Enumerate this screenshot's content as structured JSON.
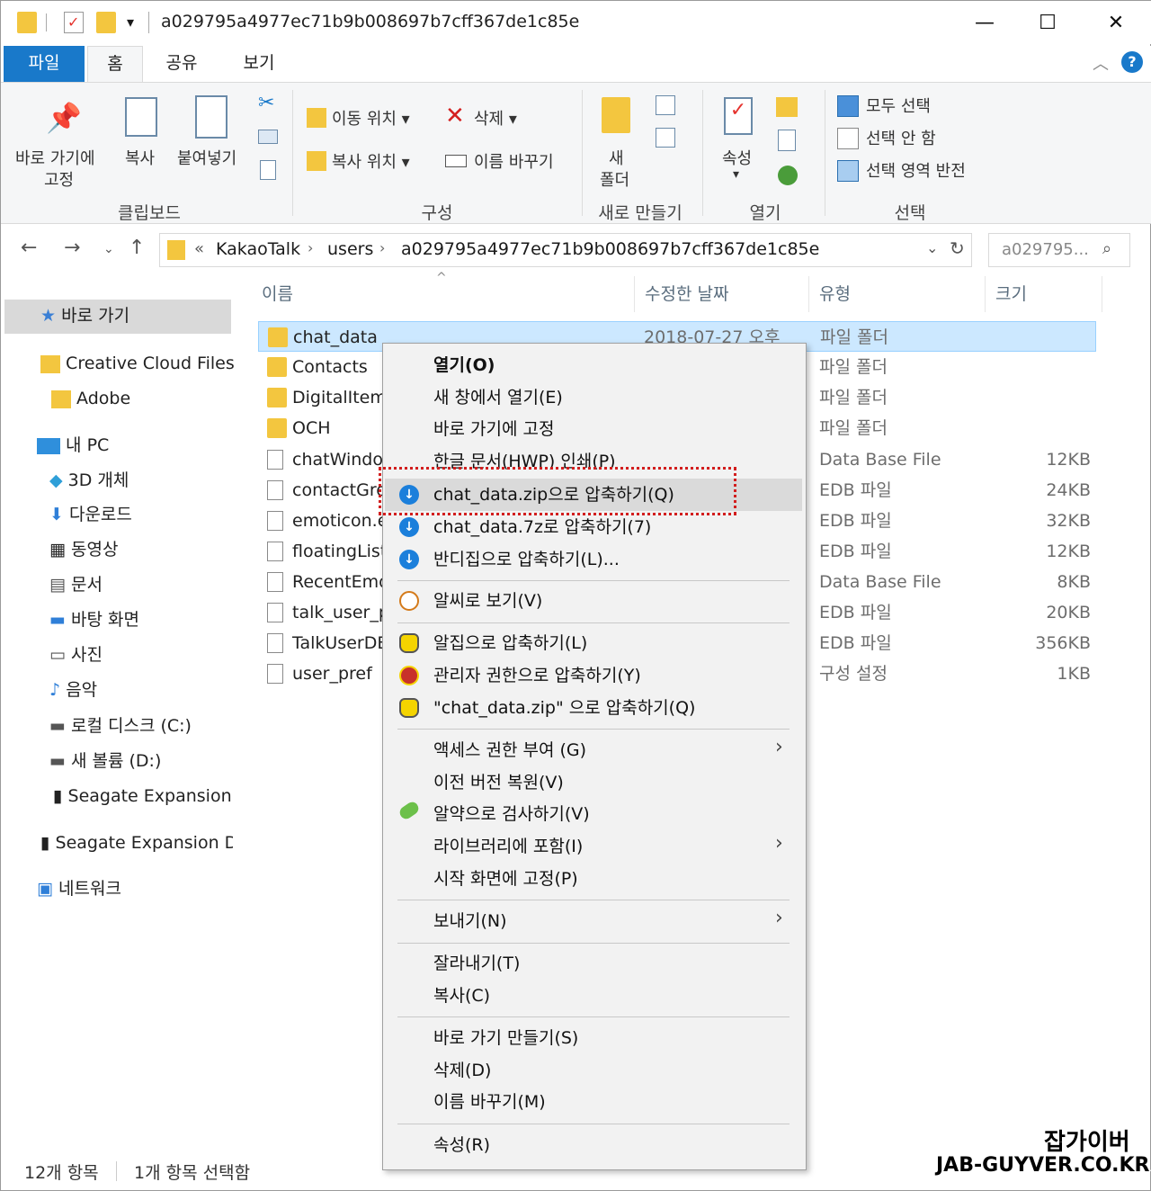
{
  "window": {
    "title": "a029795a4977ec71b9b008697b7cff367de1c85e",
    "min": "—",
    "max": "☐",
    "close": "✕"
  },
  "tabs": {
    "file": "파일",
    "home": "홈",
    "share": "공유",
    "view": "보기"
  },
  "ribbon": {
    "pin_quick": "바로 가기에\n고정",
    "pin_line1": "바로 가기에",
    "pin_line2": "고정",
    "copy": "복사",
    "paste": "붙여넣기",
    "group_clipboard": "클립보드",
    "move_to": "이동 위치 ▾",
    "copy_to": "복사 위치 ▾",
    "delete": "삭제 ▾",
    "rename": "이름 바꾸기",
    "group_organize": "구성",
    "new_line1": "새",
    "new_line2": "폴더",
    "group_new": "새로 만들기",
    "properties": "속성",
    "group_open": "열기",
    "select_all": "모두 선택",
    "select_none": "선택 안 함",
    "invert_selection": "선택 영역 반전",
    "group_select": "선택"
  },
  "address": {
    "prefix": "«",
    "crumbs": [
      "KakaoTalk",
      "users",
      "a029795a4977ec71b9b008697b7cff367de1c85e"
    ],
    "search_placeholder": "a029795..."
  },
  "nav": {
    "quick_access": "바로 가기",
    "items": [
      "Creative Cloud Files",
      "Adobe",
      "내 PC",
      "3D 개체",
      "다운로드",
      "동영상",
      "문서",
      "바탕 화면",
      "사진",
      "음악",
      "로컬 디스크 (C:)",
      "새 볼륨 (D:)",
      "Seagate Expansion",
      "Seagate Expansion D",
      "네트워크"
    ]
  },
  "columns": {
    "name": "이름",
    "modified": "수정한 날짜",
    "type": "유형",
    "size": "크기"
  },
  "files": [
    {
      "name": "chat_data",
      "date": "2018-07-27 오후",
      "type": "파일 폴더",
      "size": ""
    },
    {
      "name": "Contacts",
      "date": "",
      "type": "파일 폴더",
      "size": ""
    },
    {
      "name": "DigitalItem",
      "date": "",
      "type": "파일 폴더",
      "size": ""
    },
    {
      "name": "OCH",
      "date": "",
      "type": "파일 폴더",
      "size": ""
    },
    {
      "name": "chatWindo",
      "date": "",
      "type": "Data Base File",
      "size": "12KB"
    },
    {
      "name": "contactGro",
      "date": "",
      "type": "EDB 파일",
      "size": "24KB"
    },
    {
      "name": "emoticon.e",
      "date": "",
      "type": "EDB 파일",
      "size": "32KB"
    },
    {
      "name": "floatingList.",
      "date": "",
      "type": "EDB 파일",
      "size": "12KB"
    },
    {
      "name": "RecentEmo",
      "date": "",
      "type": "Data Base File",
      "size": "8KB"
    },
    {
      "name": "talk_user_pr",
      "date": "",
      "type": "EDB 파일",
      "size": "20KB"
    },
    {
      "name": "TalkUserDB",
      "date": "",
      "type": "EDB 파일",
      "size": "356KB"
    },
    {
      "name": "user_pref",
      "date": "",
      "type": "구성 설정",
      "size": "1KB"
    }
  ],
  "status": {
    "count": "12개 항목",
    "selected": "1개 항목 선택함"
  },
  "menu": {
    "open": "열기(O)",
    "open_new": "새 창에서 열기(E)",
    "pin": "바로 가기에 고정",
    "hwp_print": "한글 문서(HWP) 인쇄(P)",
    "zip_bandizip": "chat_data.zip으로 압축하기(Q)",
    "sevenz": "chat_data.7z로 압축하기(7)",
    "bandizip": "반디집으로 압축하기(L)...",
    "alsee": "알씨로 보기(V)",
    "alzip": "알집으로 압축하기(L)",
    "admin_zip": "관리자 권한으로 압축하기(Y)",
    "alzip_named": "\"chat_data.zip\" 으로 압축하기(Q)",
    "access": "액세스 권한 부여 (G)",
    "restore": "이전 버전 복원(V)",
    "alyac": "알약으로 검사하기(V)",
    "library": "라이브러리에 포함(I)",
    "start_pin": "시작 화면에 고정(P)",
    "send_to": "보내기(N)",
    "cut": "잘라내기(T)",
    "copy": "복사(C)",
    "shortcut": "바로 가기 만들기(S)",
    "delete": "삭제(D)",
    "rename": "이름 바꾸기(M)",
    "properties": "속성(R)"
  },
  "watermark": {
    "line1": "잡가이버",
    "line2": "JAB-GUYVER.CO.KR"
  },
  "colors": {
    "accent": "#1979ca",
    "selection": "#cce8ff",
    "highlight_box": "#d21e1e",
    "folder": "#f3c63f"
  }
}
